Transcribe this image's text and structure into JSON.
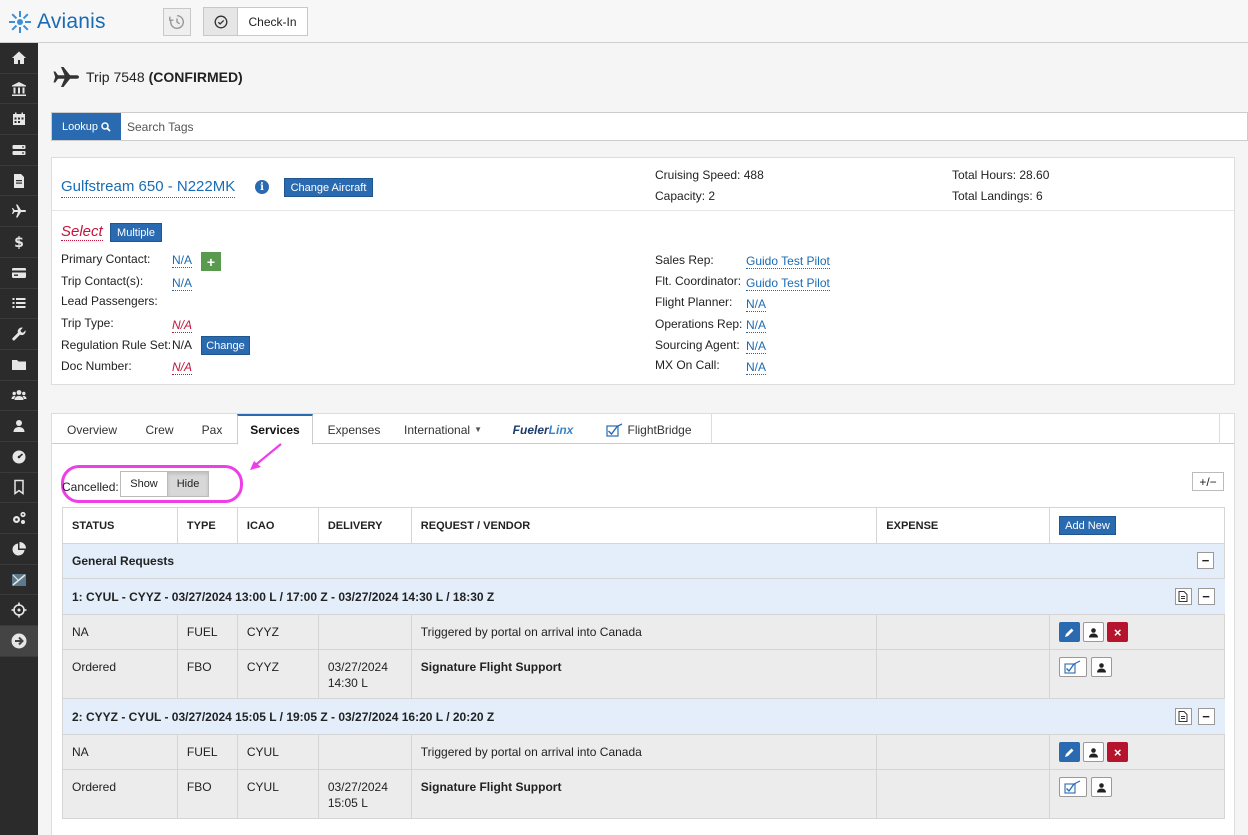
{
  "app": {
    "logo_text": "Avianis"
  },
  "toolbar": {
    "checkin_label": "Check-In"
  },
  "sidebar": {
    "items": [
      "home-icon",
      "bank-icon",
      "calendar-icon",
      "server-icon",
      "document-icon",
      "plane-icon",
      "dollar-icon",
      "credit-card-icon",
      "list-icon",
      "wrench-icon",
      "folder-icon",
      "users-icon",
      "user-icon",
      "gauge-icon",
      "bookmark-icon",
      "cogs-icon",
      "pie-chart-icon",
      "flightbridge-icon",
      "crosshair-icon",
      "arrow-right-icon"
    ]
  },
  "trip": {
    "title": "Trip 7548",
    "status": "(CONFIRMED)"
  },
  "lookup": {
    "button_label": "Lookup",
    "placeholder": "Search Tags"
  },
  "aircraft": {
    "name": "Gulfstream 650 - N222MK",
    "change_label": "Change Aircraft",
    "cruising_speed": "Cruising Speed: 488",
    "capacity": "Capacity: 2",
    "total_hours": "Total Hours: 28.60",
    "total_landings": "Total Landings: 6"
  },
  "contacts": {
    "select_label": "Select",
    "multiple_label": "Multiple",
    "primary_contact_label": "Primary Contact:",
    "primary_contact_value": "N/A",
    "trip_contacts_label": "Trip Contact(s):",
    "trip_contacts_value": "N/A",
    "lead_passengers_label": "Lead Passengers:",
    "trip_type_label": "Trip Type:",
    "trip_type_value": "N/A",
    "regulation_label": "Regulation Rule Set:",
    "regulation_value": "N/A",
    "regulation_change": "Change",
    "doc_number_label": "Doc Number:",
    "doc_number_value": "N/A"
  },
  "staff": {
    "sales_rep_label": "Sales Rep:",
    "sales_rep_value": "Guido Test Pilot",
    "flt_coordinator_label": "Flt. Coordinator:",
    "flt_coordinator_value": "Guido Test Pilot",
    "flight_planner_label": "Flight Planner:",
    "flight_planner_value": "N/A",
    "operations_rep_label": "Operations Rep:",
    "operations_rep_value": "N/A",
    "sourcing_agent_label": "Sourcing Agent:",
    "sourcing_agent_value": "N/A",
    "mx_on_call_label": "MX On Call:",
    "mx_on_call_value": "N/A"
  },
  "tabs": [
    "Overview",
    "Crew",
    "Pax",
    "Services",
    "Expenses",
    "International",
    "FuelerLinx",
    "FlightBridge"
  ],
  "fuelerlinx": {
    "part1": "Fueler",
    "part2": "Linx"
  },
  "cancelled": {
    "label": "Cancelled:",
    "show": "Show",
    "hide": "Hide"
  },
  "services": {
    "toggle_label": "+/−",
    "headers": [
      "STATUS",
      "TYPE",
      "ICAO",
      "DELIVERY",
      "REQUEST / VENDOR",
      "EXPENSE"
    ],
    "add_new": "Add New",
    "general_requests": "General Requests",
    "legs": [
      {
        "title": "1: CYUL - CYYZ - 03/27/2024 13:00 L / 17:00 Z - 03/27/2024 14:30 L / 18:30 Z",
        "rows": [
          {
            "status": "NA",
            "type": "FUEL",
            "icao": "CYYZ",
            "delivery1": "",
            "delivery2": "",
            "request": "Triggered by portal on arrival into Canada"
          },
          {
            "status": "Ordered",
            "type": "FBO",
            "icao": "CYYZ",
            "delivery1": "03/27/2024",
            "delivery2": "14:30 L",
            "request": "Signature Flight Support"
          }
        ]
      },
      {
        "title": "2: CYYZ - CYUL - 03/27/2024 15:05 L / 19:05 Z - 03/27/2024 16:20 L / 20:20 Z",
        "rows": [
          {
            "status": "NA",
            "type": "FUEL",
            "icao": "CYUL",
            "delivery1": "",
            "delivery2": "",
            "request": "Triggered by portal on arrival into Canada"
          },
          {
            "status": "Ordered",
            "type": "FBO",
            "icao": "CYUL",
            "delivery1": "03/27/2024",
            "delivery2": "15:05 L",
            "request": "Signature Flight Support"
          }
        ]
      }
    ]
  },
  "colors": {
    "accent": "#2a6ab0",
    "highlight": "#ee3ee8",
    "danger": "#b5142c",
    "link_red": "#c4143c"
  }
}
